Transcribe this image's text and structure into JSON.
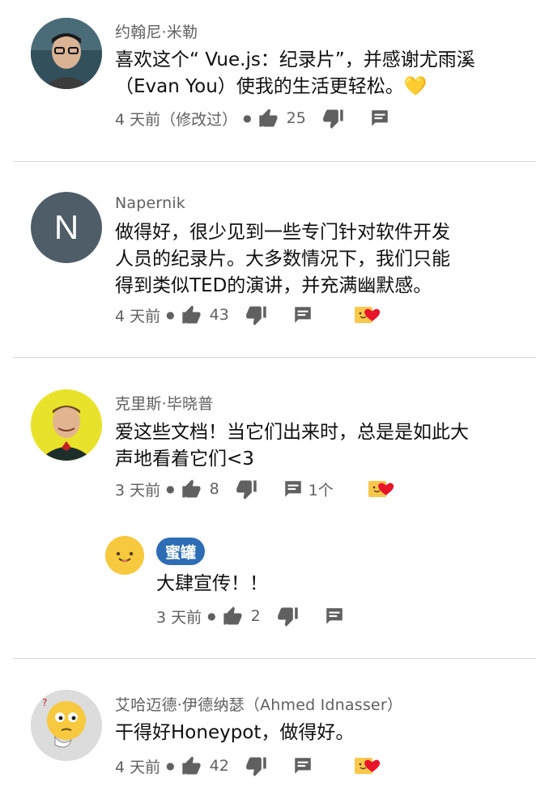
{
  "comments": [
    {
      "author": "约翰尼·米勒",
      "lines": [
        "喜欢这个“ Vue.js：纪录片”，并感谢尤雨溪",
        "（Evan You）使我的生活更轻松。💛"
      ],
      "time": "4 天前（修改过）",
      "likes": "25"
    },
    {
      "author": "Napernik",
      "avatar_letter": "N",
      "lines": [
        "做得好，很少见到一些专门针对软件开发",
        "人员的纪录片。大多数情况下，我们只能",
        "得到类似TED的演讲，并充满幽默感。"
      ],
      "time": "4 天前",
      "likes": "43"
    },
    {
      "author": "克里斯·毕晓普",
      "lines": [
        "爱这些文档！当它们出来时，总是是如此大",
        "声地看着它们<3"
      ],
      "time": "3 天前",
      "likes": "8",
      "replies": "1个"
    },
    {
      "author": "艾哈迈德·伊德纳瑟（Ahmed Idnasser）",
      "lines": [
        "干得好Honeypot，做得好。"
      ],
      "time": "4 天前",
      "likes": "42"
    }
  ],
  "reply": {
    "author_chip": "蜜罐",
    "text": "大肆宣传！！",
    "time": "3 天前",
    "likes": "2"
  },
  "colors": {
    "text": "#0f0f0f",
    "meta": "#606060",
    "chip": "#2d6db5",
    "heart": "#e8142a"
  }
}
